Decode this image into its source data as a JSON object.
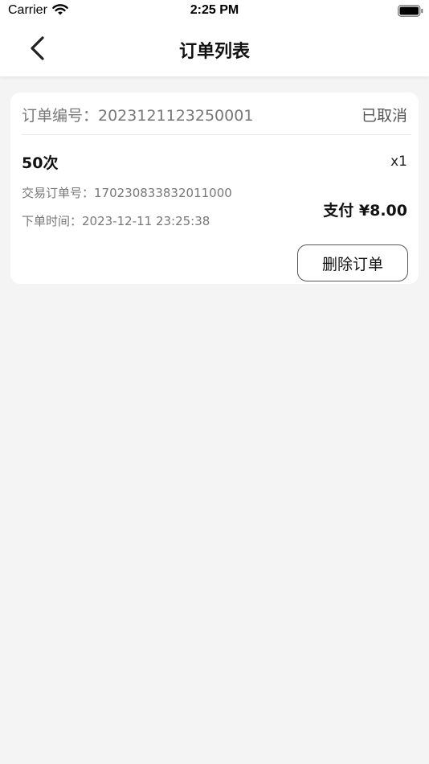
{
  "status_bar": {
    "carrier": "Carrier",
    "time": "2:25 PM",
    "icons": [
      "wifi-icon",
      "battery-icon"
    ]
  },
  "nav": {
    "title": "订单列表",
    "back_icon": "chevron-left-icon"
  },
  "orders": [
    {
      "order_no": "订单编号：2023121123250001",
      "status": "已取消",
      "product": "50次",
      "quantity": "x1",
      "trade_no": "交易订单号：170230833832011000",
      "order_time": "下单时间：2023-12-11 23:25:38",
      "pay": "支付 ¥8.00",
      "delete_label": "删除订单"
    }
  ],
  "colors": {
    "background": "#f4f4f4",
    "card": "#ffffff",
    "secondary_text": "#777777",
    "primary_text": "#111111"
  }
}
